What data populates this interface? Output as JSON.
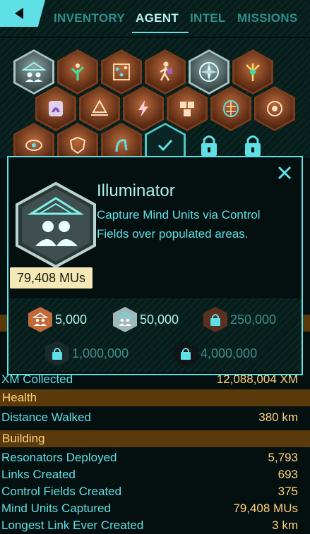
{
  "nav": {
    "tabs": [
      {
        "label": "INVENTORY",
        "active": false
      },
      {
        "label": "AGENT",
        "active": true
      },
      {
        "label": "INTEL",
        "active": false
      },
      {
        "label": "MISSIONS",
        "active": false
      }
    ]
  },
  "colors": {
    "accent": "#5fe0e6",
    "gold": "#ffd27a",
    "section_bg": "#5a3a0b",
    "bronze": "#b86a3b",
    "silver": "#a8c5c5"
  },
  "badge_detail": {
    "title": "Illuminator",
    "description": "Capture Mind Units via Control Fields over populated areas.",
    "total": "79,408 MUs",
    "tiers": [
      {
        "value": "5,000",
        "state": "bronze"
      },
      {
        "value": "50,000",
        "state": "silver"
      },
      {
        "value": "250,000",
        "state": "locked"
      },
      {
        "value": "1,000,000",
        "state": "locked"
      },
      {
        "value": "4,000,000",
        "state": "locked"
      }
    ]
  },
  "stats": {
    "partial_rows": [
      {
        "label": "XM Collected",
        "value": "12,088,004 XM"
      }
    ],
    "sections": [
      {
        "title": "Health",
        "rows": [
          {
            "label": "Distance Walked",
            "value": "380 km"
          }
        ]
      },
      {
        "title": "Building",
        "rows": [
          {
            "label": "Resonators Deployed",
            "value": "5,793"
          },
          {
            "label": "Links Created",
            "value": "693"
          },
          {
            "label": "Control Fields Created",
            "value": "375"
          },
          {
            "label": "Mind Units Captured",
            "value": "79,408 MUs"
          },
          {
            "label": "Longest Link Ever Created",
            "value": "3 km"
          }
        ]
      }
    ]
  }
}
